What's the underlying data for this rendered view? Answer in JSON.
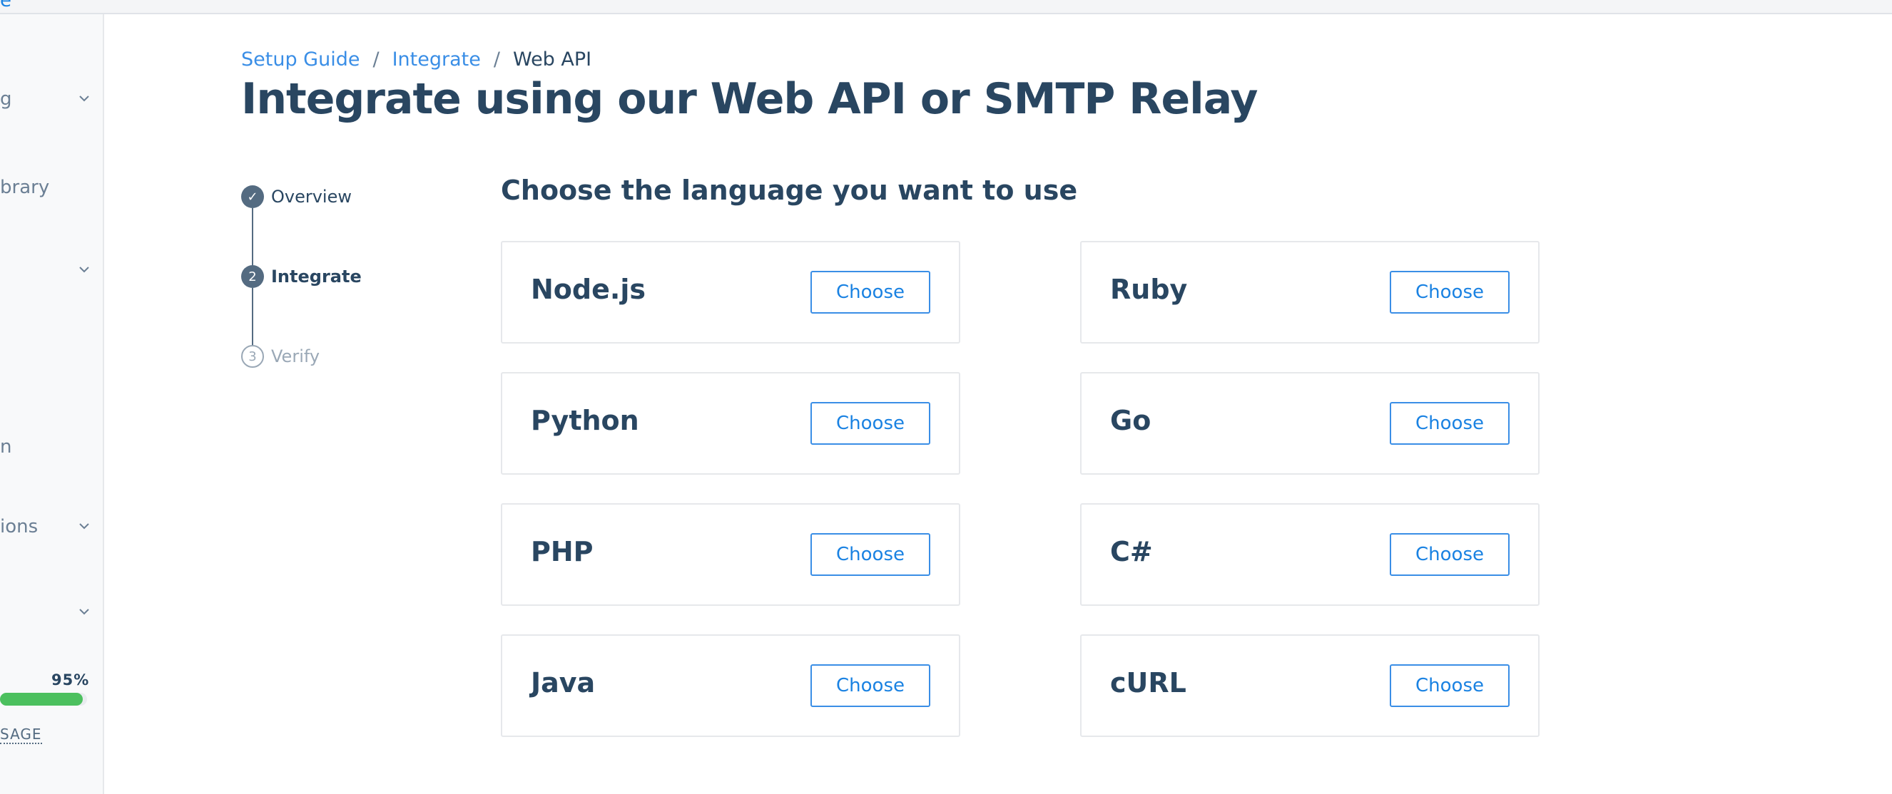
{
  "topbar": {
    "fragment": "e"
  },
  "sidebar": {
    "items": [
      {
        "label": "g",
        "has_chevron": true
      },
      {
        "label": "brary",
        "has_chevron": false
      },
      {
        "label": "",
        "has_chevron": true
      },
      {
        "label": "n",
        "has_chevron": false
      },
      {
        "label": "ions",
        "has_chevron": true
      },
      {
        "label": "",
        "has_chevron": true
      }
    ],
    "usage": {
      "percent_label": "95%",
      "percent": 95,
      "link_label": "SAGE"
    },
    "colors": {
      "usage_bar": "#4cc05e"
    }
  },
  "breadcrumb": {
    "items": [
      "Setup Guide",
      "Integrate",
      "Web API"
    ],
    "separator": "/"
  },
  "page": {
    "title": "Integrate using our Web API or SMTP Relay"
  },
  "steps": [
    {
      "label": "Overview",
      "state": "done",
      "marker": "✓"
    },
    {
      "label": "Integrate",
      "state": "active",
      "marker": "2"
    },
    {
      "label": "Verify",
      "state": "todo",
      "marker": "3"
    }
  ],
  "main": {
    "section_title": "Choose the language you want to use",
    "button_label": "Choose",
    "languages": [
      "Node.js",
      "Ruby",
      "Python",
      "Go",
      "PHP",
      "C#",
      "Java",
      "cURL"
    ]
  },
  "colors": {
    "primary_text": "#294661",
    "link": "#1a82e2",
    "border": "#e6e8eb"
  }
}
